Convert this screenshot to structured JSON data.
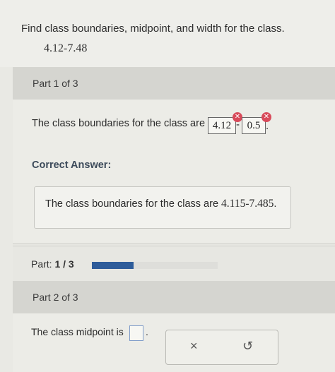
{
  "question": {
    "prompt": "Find class boundaries, midpoint, and width for the class.",
    "class_range": "4.12-7.48"
  },
  "part1": {
    "header": "Part 1 of 3",
    "boundaries_text": "The class boundaries for the class are",
    "answer_lower": "4.12",
    "answer_upper": "0.5",
    "dash": "-",
    "period": ".",
    "correct_label": "Correct Answer:",
    "correct_text": "The class boundaries for the class are",
    "correct_value": "4.115-7.485",
    "correct_period": "."
  },
  "progress": {
    "label_prefix": "Part:",
    "label_value": "1 / 3",
    "fraction": 0.333,
    "color": "#2e5c9a"
  },
  "part2": {
    "header": "Part 2 of 3",
    "midpoint_text": "The class midpoint is",
    "period": "."
  },
  "tools": {
    "clear_symbol": "×",
    "undo_symbol": "↺"
  },
  "colors": {
    "wrong": "#d84a5a"
  }
}
